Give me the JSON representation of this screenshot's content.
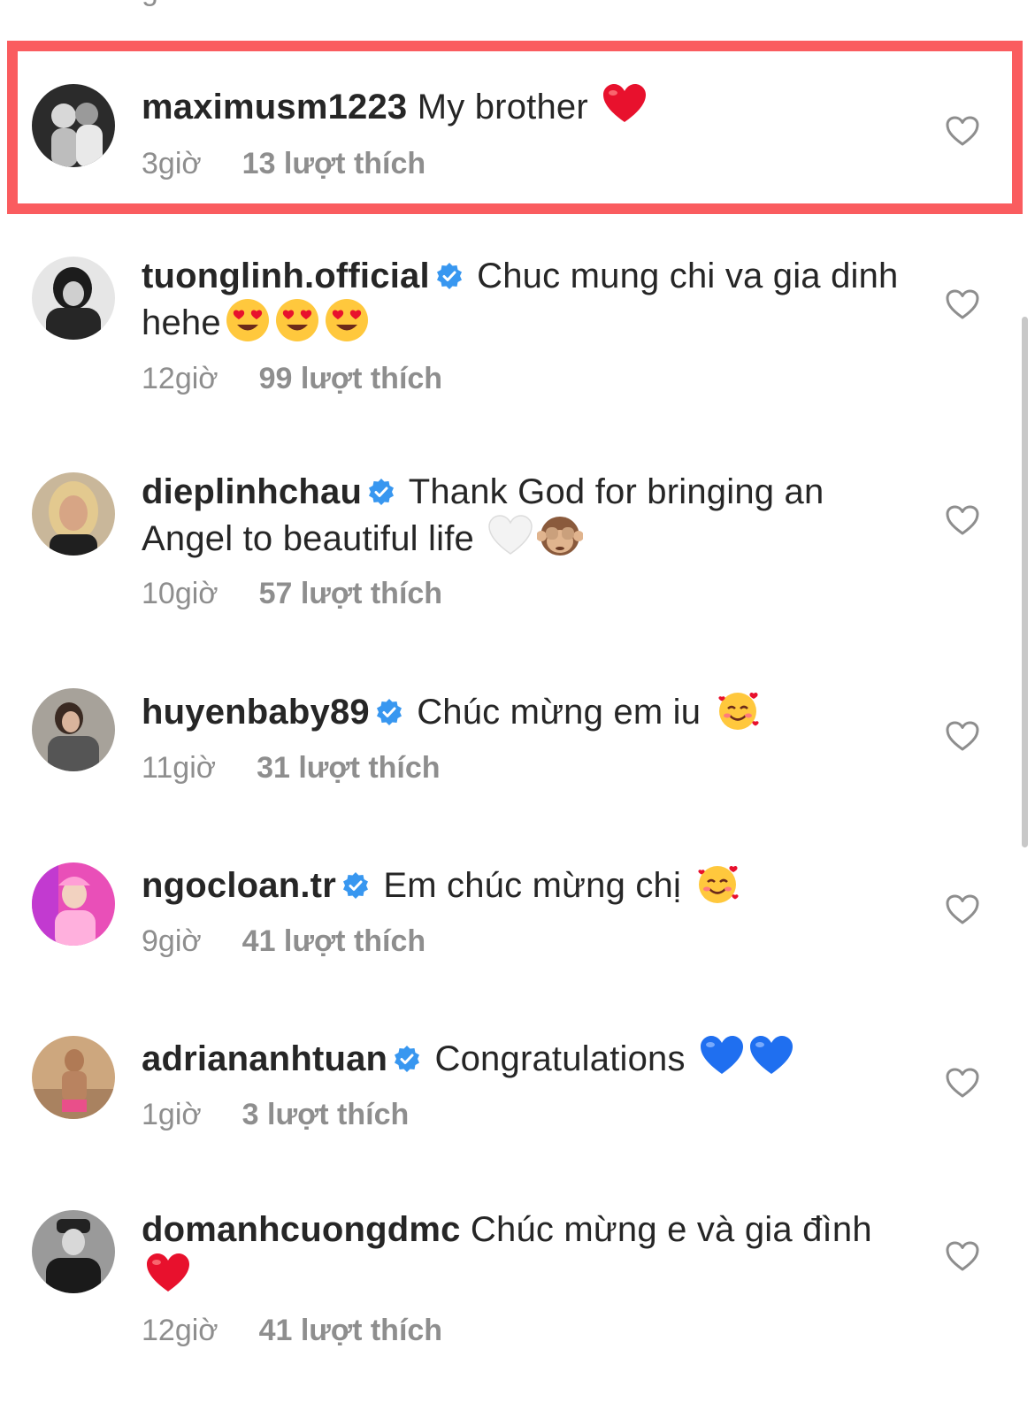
{
  "comments": [
    {
      "username": "maximusm1223",
      "verified": false,
      "text": "My brother",
      "emojis": [
        "red-heart"
      ],
      "time": "3giờ",
      "likes": "13 lượt thích"
    },
    {
      "username": "tuonglinh.official",
      "verified": true,
      "text": "Chuc mung chi va gia dinh hehe",
      "emojis": [
        "heart-eyes",
        "heart-eyes",
        "heart-eyes"
      ],
      "time": "12giờ",
      "likes": "99 lượt thích"
    },
    {
      "username": "dieplinhchau",
      "verified": true,
      "text": "Thank God for bringing an Angel to beautiful life",
      "emojis": [
        "white-heart",
        "see-no-evil-monkey"
      ],
      "time": "10giờ",
      "likes": "57 lượt thích"
    },
    {
      "username": "huyenbaby89",
      "verified": true,
      "text": "Chúc mừng em iu",
      "emojis": [
        "smiling-face-with-hearts"
      ],
      "time": "11giờ",
      "likes": "31 lượt thích"
    },
    {
      "username": "ngocloan.tr",
      "verified": true,
      "text": "Em chúc mừng chị",
      "emojis": [
        "smiling-face-with-hearts"
      ],
      "time": "9giờ",
      "likes": "41 lượt thích"
    },
    {
      "username": "adriananhtuan",
      "verified": true,
      "text": "Congratulations",
      "emojis": [
        "blue-heart",
        "blue-heart"
      ],
      "time": "1giờ",
      "likes": "3 lượt thích"
    },
    {
      "username": "domanhcuongdmc",
      "verified": false,
      "text": "Chúc mừng e và gia đình",
      "emojis": [
        "red-heart"
      ],
      "time": "12giờ",
      "likes": "41 lượt thích"
    }
  ],
  "colors": {
    "highlight_border": "#fa5c5f",
    "verified_badge": "#3897f0",
    "meta_text": "#8e8e8e",
    "primary_text": "#262626"
  },
  "icons": {
    "like_button": "heart-outline-icon",
    "verified_badge": "verified-badge-icon"
  }
}
